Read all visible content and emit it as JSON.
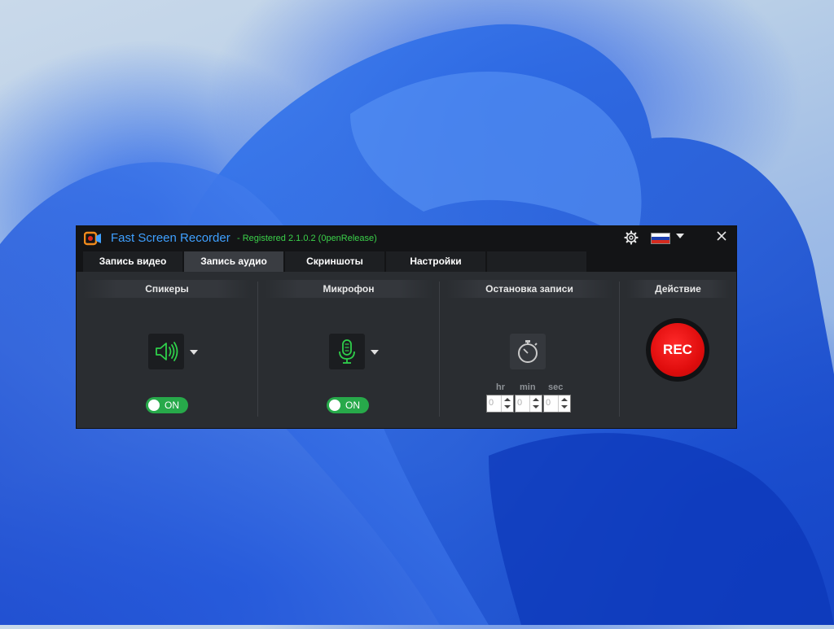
{
  "app": {
    "title": "Fast Screen Recorder",
    "version": "- Registered 2.1.0.2 (0penRelease)",
    "accent_color": "#3fa0ff",
    "registered_color": "#3bd14a"
  },
  "titlebar": {
    "settings_icon": "gear-icon",
    "language_flag": "russia-flag-icon",
    "close_icon": "close-icon"
  },
  "tabs": [
    {
      "label": "Запись видео",
      "active": false
    },
    {
      "label": "Запись аудио",
      "active": true
    },
    {
      "label": "Скриншоты",
      "active": false
    },
    {
      "label": "Настройки",
      "active": false
    }
  ],
  "speakers": {
    "title": "Спикеры",
    "icon": "speaker-icon",
    "toggle_label": "ON"
  },
  "microphone": {
    "title": "Микрофон",
    "icon": "microphone-icon",
    "toggle_label": "ON"
  },
  "stop_recording": {
    "title": "Остановка записи",
    "icon": "stopwatch-icon",
    "hr_label": "hr",
    "min_label": "min",
    "sec_label": "sec",
    "hr_value": "0",
    "min_value": "0",
    "sec_value": "0"
  },
  "action": {
    "title": "Действие",
    "rec_label": "REC",
    "rec_color": "#e00d0d"
  },
  "colors": {
    "toggle_on": "#27a94a",
    "icon_green": "#2fcf4a"
  }
}
